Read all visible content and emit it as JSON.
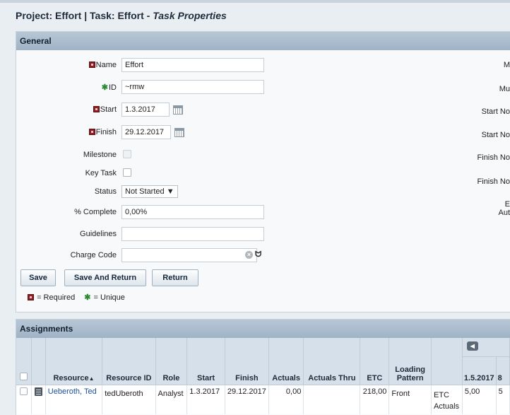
{
  "page": {
    "title_prefix": "Project: Effort | Task: Effort - ",
    "title_suffix": "Task Properties"
  },
  "general": {
    "header": "General",
    "fields": {
      "name_label": "Name",
      "name_value": "Effort",
      "id_label": "ID",
      "id_value": "~rmw",
      "start_label": "Start",
      "start_value": "1.3.2017",
      "finish_label": "Finish",
      "finish_value": "29.12.2017",
      "milestone_label": "Milestone",
      "key_task_label": "Key Task",
      "status_label": "Status",
      "status_value": "Not Started ▼",
      "percent_label": "% Complete",
      "percent_value": "0,00%",
      "guidelines_label": "Guidelines",
      "guidelines_value": "",
      "charge_code_label": "Charge Code",
      "charge_code_value": ""
    },
    "right_labels": [
      "M",
      "Mu",
      "Start No",
      "Start No",
      "Finish No",
      "Finish No",
      "E",
      "Aut"
    ],
    "buttons": {
      "save": "Save",
      "save_and_return": "Save And Return",
      "return": "Return"
    },
    "legend": {
      "required": "= Required",
      "unique": "= Unique"
    }
  },
  "assignments": {
    "header": "Assignments",
    "columns": {
      "resource": "Resource",
      "resource_id": "Resource ID",
      "role": "Role",
      "start": "Start",
      "finish": "Finish",
      "actuals": "Actuals",
      "actuals_thru": "Actuals Thru",
      "etc": "ETC",
      "loading_pattern_1": "Loading",
      "loading_pattern_2": "Pattern",
      "period_1": "1.5.2017",
      "period_2": "8"
    },
    "rows": [
      {
        "resource": "Ueberoth, Ted",
        "resource_id": "tedUberoth",
        "role": "Analyst",
        "start": "1.3.2017",
        "finish": "29.12.2017",
        "actuals": "0,00",
        "actuals_thru": "",
        "etc": "218,00",
        "loading_pattern": "Front",
        "type_1": "ETC",
        "type_2": "Actuals",
        "period_1": "5,00",
        "period_2": "5"
      }
    ]
  }
}
